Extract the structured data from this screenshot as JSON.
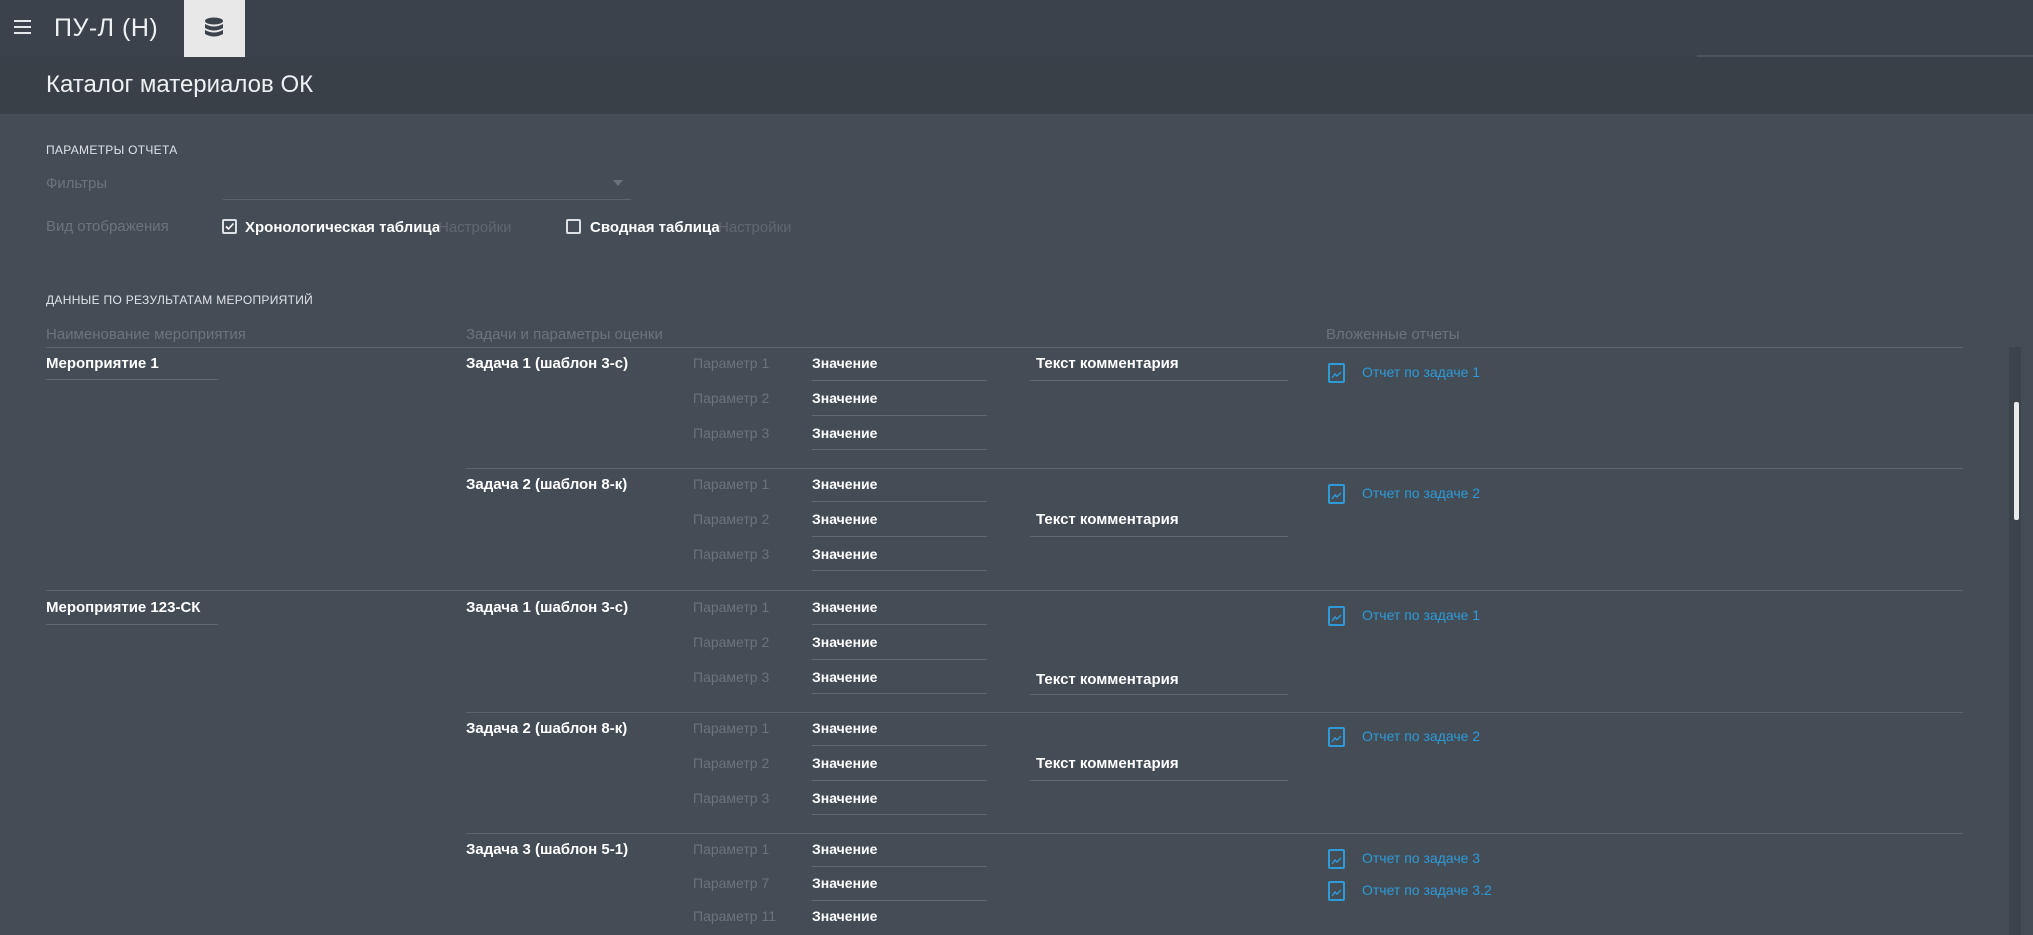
{
  "header": {
    "app_title": "ПУ-Л (Н)",
    "menu_icon": "menu-icon",
    "database_icon": "database-icon"
  },
  "page": {
    "title": "Каталог материалов ОК"
  },
  "params": {
    "section_label": "ПАРАМЕТРЫ ОТЧЕТА",
    "filters_label": "Фильтры",
    "filters_value": "",
    "display_label": "Вид отображения",
    "chrono_label": "Хронологическая таблица",
    "chrono_checked": true,
    "chrono_settings": "Настройки",
    "pivot_label": "Сводная таблица",
    "pivot_checked": false,
    "pivot_settings": "Настройки"
  },
  "results": {
    "section_label": "ДАННЫЕ ПО РЕЗУЛЬТАТАМ МЕРОПРИЯТИЙ",
    "columns": [
      "Наименование мероприятия",
      "Задачи и параметры оценки",
      "Вложенные отчеты"
    ],
    "events": [
      {
        "name": "Мероприятие 1",
        "tasks": [
          {
            "name": "Задача 1 (шаблон 3-с)",
            "params": [
              {
                "label": "Параметр 1",
                "value": "Значение"
              },
              {
                "label": "Параметр 2",
                "value": "Значение"
              },
              {
                "label": "Параметр 3",
                "value": "Значение"
              }
            ],
            "comment": "Текст комментария",
            "reports": [
              "Отчет по задаче 1"
            ]
          },
          {
            "name": "Задача 2 (шаблон 8-к)",
            "params": [
              {
                "label": "Параметр 1",
                "value": "Значение"
              },
              {
                "label": "Параметр 2",
                "value": "Значение"
              },
              {
                "label": "Параметр 3",
                "value": "Значение"
              }
            ],
            "comment": "Текст комментария",
            "reports": [
              "Отчет по задаче 2"
            ]
          }
        ]
      },
      {
        "name": "Мероприятие 123-СК",
        "tasks": [
          {
            "name": "Задача 1 (шаблон 3-с)",
            "params": [
              {
                "label": "Параметр 1",
                "value": "Значение"
              },
              {
                "label": "Параметр 2",
                "value": "Значение"
              },
              {
                "label": "Параметр 3",
                "value": "Значение"
              }
            ],
            "comment": "Текст комментария",
            "reports": [
              "Отчет по задаче 1"
            ]
          },
          {
            "name": "Задача 2 (шаблон 8-к)",
            "params": [
              {
                "label": "Параметр 1",
                "value": "Значение"
              },
              {
                "label": "Параметр 2",
                "value": "Значение"
              },
              {
                "label": "Параметр 3",
                "value": "Значение"
              }
            ],
            "comment": "Текст комментария",
            "reports": [
              "Отчет по задаче 2"
            ]
          },
          {
            "name": "Задача 3 (шаблон 5-1)",
            "params": [
              {
                "label": "Параметр 1",
                "value": "Значение"
              },
              {
                "label": "Параметр 7",
                "value": "Значение"
              },
              {
                "label": "Параметр 11",
                "value": "Значение"
              }
            ],
            "comment": "",
            "reports": [
              "Отчет по задаче 3",
              "Отчет по задаче 3.2"
            ]
          }
        ]
      }
    ]
  },
  "colors": {
    "background": "#444c56",
    "app_bar": "#3b424b",
    "page_header": "#3a4048",
    "link": "#2e9ad7",
    "muted_text": "#6b737c"
  }
}
